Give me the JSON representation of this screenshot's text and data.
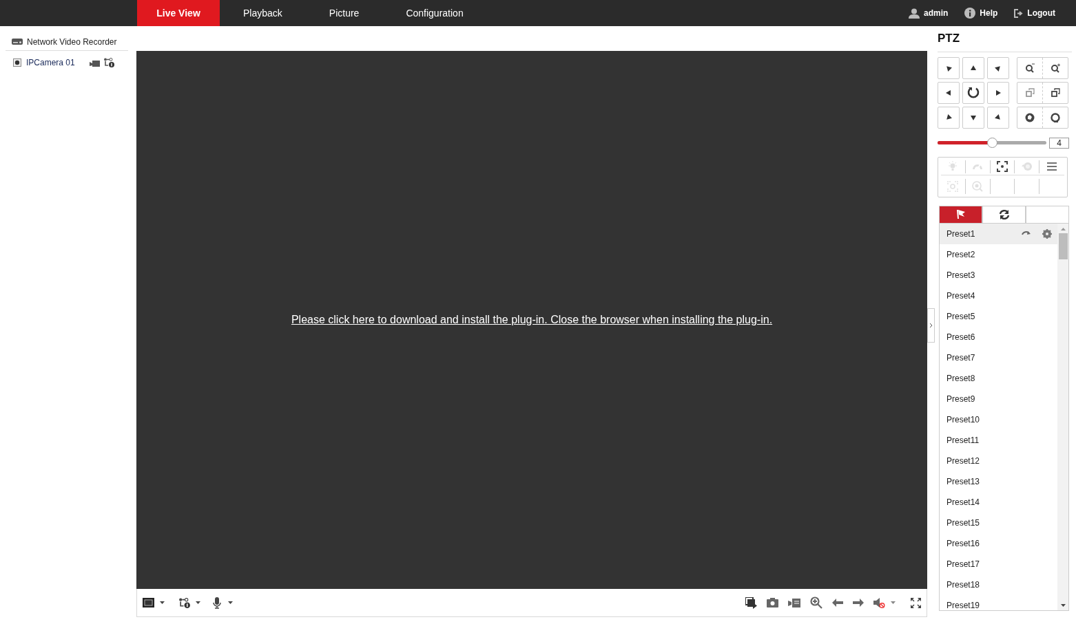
{
  "nav": {
    "tabs": [
      {
        "label": "Live View",
        "selected": true
      },
      {
        "label": "Playback",
        "selected": false
      },
      {
        "label": "Picture",
        "selected": false
      },
      {
        "label": "Configuration",
        "selected": false
      }
    ],
    "user": [
      {
        "kind": "user",
        "label": "admin"
      },
      {
        "kind": "help",
        "label": "Help"
      },
      {
        "kind": "logout",
        "label": "Logout"
      }
    ]
  },
  "device_tree": {
    "root": "Network Video Recorder",
    "channels": [
      {
        "label": "IPCamera 01"
      }
    ]
  },
  "video": {
    "message": "Please click here to download and install the plug-in. Close the browser when installing the plug-in."
  },
  "ptz": {
    "title": "PTZ",
    "speed": {
      "level": 0.5,
      "value": "4"
    },
    "tools": [
      {
        "kind": "light",
        "disabled": true
      },
      {
        "kind": "wiper",
        "disabled": true
      },
      {
        "kind": "focus",
        "disabled": false
      },
      {
        "kind": "reset",
        "disabled": true
      },
      {
        "kind": "menu",
        "disabled": false
      },
      {
        "kind": "area",
        "disabled": true
      },
      {
        "kind": "zoom3d",
        "disabled": true
      }
    ],
    "tabs": [
      {
        "kind": "preset",
        "selected": true
      },
      {
        "kind": "patrol",
        "selected": false
      },
      {
        "kind": "blank",
        "selected": false
      }
    ],
    "presets": [
      {
        "label": "Preset1",
        "selected": true
      },
      {
        "label": "Preset2",
        "selected": false
      },
      {
        "label": "Preset3",
        "selected": false
      },
      {
        "label": "Preset4",
        "selected": false
      },
      {
        "label": "Preset5",
        "selected": false
      },
      {
        "label": "Preset6",
        "selected": false
      },
      {
        "label": "Preset7",
        "selected": false
      },
      {
        "label": "Preset8",
        "selected": false
      },
      {
        "label": "Preset9",
        "selected": false
      },
      {
        "label": "Preset10",
        "selected": false
      },
      {
        "label": "Preset11",
        "selected": false
      },
      {
        "label": "Preset12",
        "selected": false
      },
      {
        "label": "Preset13",
        "selected": false
      },
      {
        "label": "Preset14",
        "selected": false
      },
      {
        "label": "Preset15",
        "selected": false
      },
      {
        "label": "Preset16",
        "selected": false
      },
      {
        "label": "Preset17",
        "selected": false
      },
      {
        "label": "Preset18",
        "selected": false
      },
      {
        "label": "Preset19",
        "selected": false
      }
    ]
  }
}
